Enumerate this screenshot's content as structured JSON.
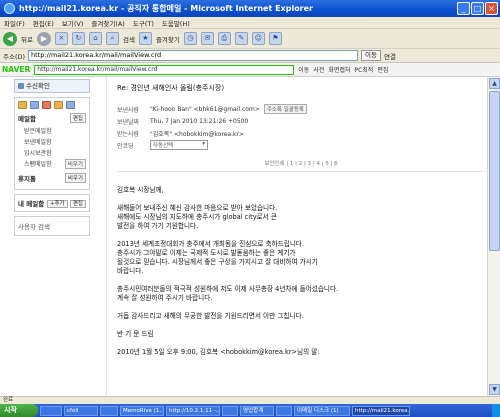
{
  "window": {
    "title": "http://mail21.korea.kr - 공직자 통합메일 - Microsoft Internet Explorer",
    "menu": [
      "파일(F)",
      "편집(E)",
      "보기(V)",
      "즐겨찾기(A)",
      "도구(T)",
      "도움말(H)"
    ]
  },
  "toolbar": {
    "back": "뒤로",
    "search": "검색",
    "favorites": "즐겨찾기"
  },
  "address": {
    "label": "주소(D)",
    "url": "http://mail21.korea.kr/mail/mailView.crd",
    "go": "이동",
    "links": "연결"
  },
  "naver": {
    "logo": "NAVER",
    "url": "http://mail21.korea.kr/mail/mailView.crd",
    "items": [
      "이동",
      "사전",
      "화면캡처",
      "PC최적",
      "편집"
    ]
  },
  "sidebar": {
    "inbox_button": "수신확인",
    "mail_section": "메일함",
    "mail_btn": "편집",
    "folders": [
      {
        "name": "받은메일함",
        "count": ""
      },
      {
        "name": "보낸메일함",
        "count": ""
      },
      {
        "name": "임시보관함",
        "count": ""
      },
      {
        "name": "스팸메일함",
        "count": "비우기"
      }
    ],
    "trash": "휴지통",
    "trash_btn": "비우기",
    "my_folder": "내 메일함",
    "my_folder_btn": "+추가",
    "my_folder_btn2": "편집",
    "search": "사용자 검색"
  },
  "mail": {
    "subject": "Re: 경인년 새해인사 올림(충주시장)",
    "from_label": "보낸사람",
    "from_value": "\"Ki-hoon Ban\" <bhk61@gmail.com>",
    "add_btn": "주소록 일괄등록",
    "date_label": "보낸날짜",
    "date_value": "Thu, 7 Jan 2010 13:21:26 +0500",
    "to_label": "받는사람",
    "to_value": "\"김호복\" <hobokkim@korea.kr>",
    "enc_label": "인코딩",
    "enc_value": "자동선택",
    "pager": "보안인쇄 | 1 | 2 | 3 | 4 | 5 | 6",
    "pager_current": "3",
    "body": [
      "김호복 시장님께,",
      "새해들어 보내주신 혜신 감사한 마음으로 받아 보았습니다.|새해에도 시장님의 지도하에 충주시가 global city로서 큰|발전을 하여 가기 기원합니다.",
      "2013년 세계조정대회가 충주에서 개최됨을 진심으로 축하드립니다.|충주시가 그야말로 이제는 국제적 도시로 발돋움하는 좋은 계기가|될것으로 믿습니다. 시장님께서 좋은 구상을 가지시고 잘 대비하여 가시기|바랍니다.",
      "충주시민여러분들의 적극적 성원하에 저도 이제 사무총장 4년차에 들어섰습니다.|계속 잘 성원하여 주시기 바랍니다.",
      "거듭 감사드리고 새해의 무궁한 발전을 기원드리면서 이만 그칩니다.",
      "반 기 문 드림",
      "2010년 1월 5일 오후 9:00, 김호복 <hobokkim@korea.kr>님의 말:"
    ]
  },
  "status": {
    "text": "완료"
  },
  "taskbar": {
    "start": "시작",
    "tasks": [
      "",
      "cfoli",
      "",
      "MemoRive (1..",
      "http://10.2.1.11 -..",
      "",
      "영업합계",
      "",
      "이메일 디스크 (1)",
      "http://mail21.korea..",
      ""
    ],
    "clock": ""
  }
}
